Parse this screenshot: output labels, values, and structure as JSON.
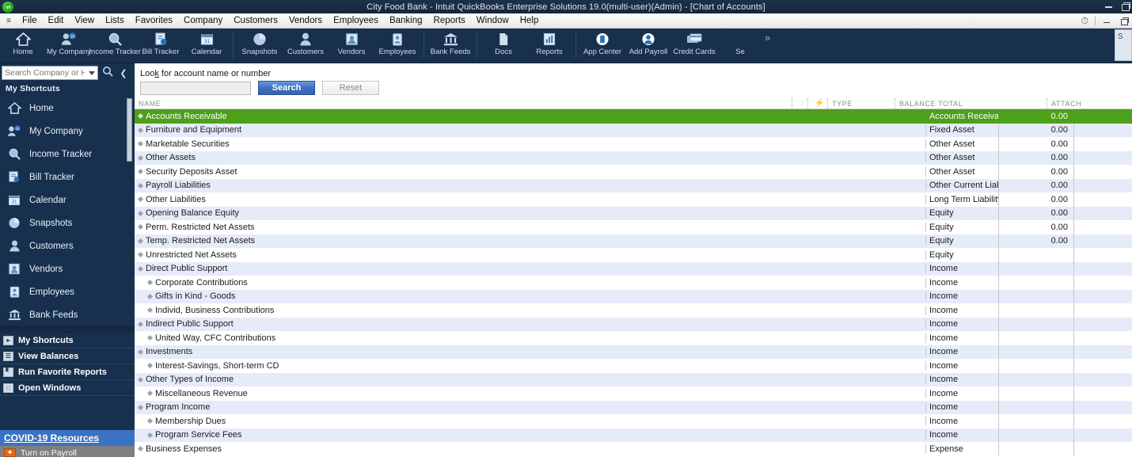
{
  "window": {
    "title": "City Food Bank  - Intuit QuickBooks Enterprise Solutions 19.0(multi-user)(Admin) - [Chart of Accounts]",
    "logo_glyph": "qb",
    "minimize_label": "Minimize",
    "restore_label": "Restore"
  },
  "menubar": {
    "system_glyph": "≡",
    "items": [
      {
        "label": "File"
      },
      {
        "label": "Edit"
      },
      {
        "label": "View"
      },
      {
        "label": "Lists"
      },
      {
        "label": "Favorites"
      },
      {
        "label": "Company"
      },
      {
        "label": "Customers"
      },
      {
        "label": "Vendors"
      },
      {
        "label": "Employees"
      },
      {
        "label": "Banking"
      },
      {
        "label": "Reports"
      },
      {
        "label": "Window"
      },
      {
        "label": "Help"
      }
    ],
    "clock_glyph": "⏱"
  },
  "toolbar": {
    "groups": [
      {
        "items": [
          {
            "label": "Home",
            "icon": "home-icon"
          },
          {
            "label": "My Company",
            "icon": "my-company-icon"
          },
          {
            "label": "Income Tracker",
            "icon": "income-tracker-icon"
          },
          {
            "label": "Bill Tracker",
            "icon": "bill-tracker-icon"
          },
          {
            "label": "Calendar",
            "icon": "calendar-icon"
          }
        ]
      },
      {
        "items": [
          {
            "label": "Snapshots",
            "icon": "snapshots-icon"
          },
          {
            "label": "Customers",
            "icon": "customers-icon"
          },
          {
            "label": "Vendors",
            "icon": "vendors-icon"
          },
          {
            "label": "Employees",
            "icon": "employees-icon"
          }
        ]
      },
      {
        "items": [
          {
            "label": "Bank Feeds",
            "icon": "bank-feeds-icon"
          }
        ]
      },
      {
        "items": [
          {
            "label": "Docs",
            "icon": "docs-icon"
          },
          {
            "label": "Reports",
            "icon": "reports-icon"
          }
        ]
      },
      {
        "items": [
          {
            "label": "App Center",
            "icon": "app-center-icon"
          },
          {
            "label": "Add Payroll",
            "icon": "add-payroll-icon"
          },
          {
            "label": "Credit Cards",
            "icon": "credit-cards-icon"
          },
          {
            "label": "Se",
            "icon": "services-icon"
          }
        ]
      }
    ],
    "overflow_glyph": "»",
    "right_stub": "S"
  },
  "sidebar": {
    "search": {
      "value": "",
      "placeholder": "Search Company or Help"
    },
    "search_icon": "magnifier-icon",
    "collapse_icon": "chevron-left-icon",
    "heading": "My Shortcuts",
    "items": [
      {
        "label": "Home",
        "icon": "home-icon"
      },
      {
        "label": "My Company",
        "icon": "my-company-icon"
      },
      {
        "label": "Income Tracker",
        "icon": "income-tracker-icon"
      },
      {
        "label": "Bill Tracker",
        "icon": "bill-tracker-icon"
      },
      {
        "label": "Calendar",
        "icon": "calendar-icon"
      },
      {
        "label": "Snapshots",
        "icon": "snapshots-icon"
      },
      {
        "label": "Customers",
        "icon": "customers-icon"
      },
      {
        "label": "Vendors",
        "icon": "vendors-icon"
      },
      {
        "label": "Employees",
        "icon": "employees-icon"
      },
      {
        "label": "Bank Feeds",
        "icon": "bank-feeds-icon"
      }
    ],
    "panels": [
      {
        "label": "My Shortcuts",
        "icon": "shortcuts-panel-icon"
      },
      {
        "label": "View Balances",
        "icon": "balances-panel-icon"
      },
      {
        "label": "Run Favorite Reports",
        "icon": "reports-panel-icon"
      },
      {
        "label": "Open Windows",
        "icon": "windows-panel-icon"
      }
    ],
    "covid_link": "COVID-19 Resources",
    "payroll_banner": "Turn on Payroll",
    "payroll_icon": "payroll-icon"
  },
  "search_panel": {
    "label_pre": "Loo",
    "label_key": "k",
    "label_post": " for account name or number",
    "input_value": "",
    "input_placeholder": "",
    "search_button": "Search",
    "reset_button": "Reset"
  },
  "accounts_table": {
    "columns": {
      "name": "NAME",
      "sort_grip": "⦙",
      "bolt": "⚡",
      "type": "TYPE",
      "balance": "BALANCE TOTAL",
      "attach": "ATTACH"
    },
    "rows": [
      {
        "name": "Accounts Receivable",
        "indent": 0,
        "type": "Accounts Receivable",
        "balance": "0.00",
        "attach": "",
        "selected": true
      },
      {
        "name": "Furniture and Equipment",
        "indent": 0,
        "type": "Fixed Asset",
        "balance": "0.00",
        "attach": ""
      },
      {
        "name": "Marketable Securities",
        "indent": 0,
        "type": "Other Asset",
        "balance": "0.00",
        "attach": ""
      },
      {
        "name": "Other Assets",
        "indent": 0,
        "type": "Other Asset",
        "balance": "0.00",
        "attach": ""
      },
      {
        "name": "Security Deposits Asset",
        "indent": 0,
        "type": "Other Asset",
        "balance": "0.00",
        "attach": ""
      },
      {
        "name": "Payroll Liabilities",
        "indent": 0,
        "type": "Other Current Liability",
        "balance": "0.00",
        "attach": ""
      },
      {
        "name": "Other Liabilities",
        "indent": 0,
        "type": "Long Term Liability",
        "balance": "0.00",
        "attach": ""
      },
      {
        "name": "Opening Balance Equity",
        "indent": 0,
        "type": "Equity",
        "balance": "0.00",
        "attach": ""
      },
      {
        "name": "Perm. Restricted Net Assets",
        "indent": 0,
        "type": "Equity",
        "balance": "0.00",
        "attach": ""
      },
      {
        "name": "Temp. Restricted Net Assets",
        "indent": 0,
        "type": "Equity",
        "balance": "0.00",
        "attach": ""
      },
      {
        "name": "Unrestricted Net Assets",
        "indent": 0,
        "type": "Equity",
        "balance": "",
        "attach": ""
      },
      {
        "name": "Direct Public Support",
        "indent": 0,
        "type": "Income",
        "balance": "",
        "attach": ""
      },
      {
        "name": "Corporate Contributions",
        "indent": 1,
        "type": "Income",
        "balance": "",
        "attach": ""
      },
      {
        "name": "Gifts in Kind - Goods",
        "indent": 1,
        "type": "Income",
        "balance": "",
        "attach": ""
      },
      {
        "name": "Individ, Business Contributions",
        "indent": 1,
        "type": "Income",
        "balance": "",
        "attach": ""
      },
      {
        "name": "Indirect Public Support",
        "indent": 0,
        "type": "Income",
        "balance": "",
        "attach": ""
      },
      {
        "name": "United Way, CFC Contributions",
        "indent": 1,
        "type": "Income",
        "balance": "",
        "attach": ""
      },
      {
        "name": "Investments",
        "indent": 0,
        "type": "Income",
        "balance": "",
        "attach": ""
      },
      {
        "name": "Interest-Savings, Short-term CD",
        "indent": 1,
        "type": "Income",
        "balance": "",
        "attach": ""
      },
      {
        "name": "Other Types of Income",
        "indent": 0,
        "type": "Income",
        "balance": "",
        "attach": ""
      },
      {
        "name": "Miscellaneous Revenue",
        "indent": 1,
        "type": "Income",
        "balance": "",
        "attach": ""
      },
      {
        "name": "Program Income",
        "indent": 0,
        "type": "Income",
        "balance": "",
        "attach": ""
      },
      {
        "name": "Membership Dues",
        "indent": 1,
        "type": "Income",
        "balance": "",
        "attach": ""
      },
      {
        "name": "Program Service Fees",
        "indent": 1,
        "type": "Income",
        "balance": "",
        "attach": ""
      },
      {
        "name": "Business Expenses",
        "indent": 0,
        "type": "Expense",
        "balance": "",
        "attach": ""
      }
    ]
  },
  "colors": {
    "selected_row": "#4da019",
    "alt_row": "#e6ebfa",
    "chrome_dark": "#17304e",
    "accent_blue": "#3b73c4",
    "search_button": "#3f71c0",
    "payroll_orange": "#e06a1b"
  }
}
